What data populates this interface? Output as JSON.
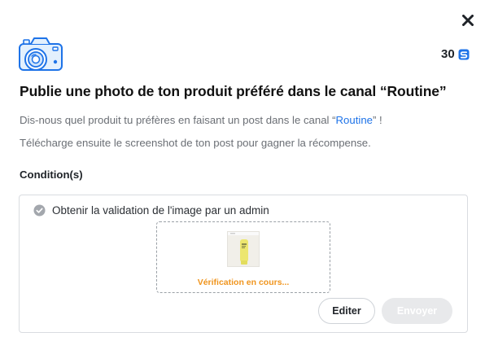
{
  "header": {
    "close_icon": "close-icon",
    "camera_icon": "camera-icon",
    "reward": {
      "value": "30",
      "icon": "coin-icon",
      "color": "#1e73e8"
    }
  },
  "challenge": {
    "title": "Publie une photo de ton produit préféré dans le canal “Routine”",
    "description_1_before": "Dis-nous quel produit tu préfères en faisant un post dans le canal “",
    "description_1_link": "Routine",
    "description_1_after": "” !",
    "description_2": "Télécharge ensuite le screenshot de ton post pour gagner la récompense."
  },
  "conditions": {
    "heading": "Condition(s)",
    "items": [
      {
        "label": "Obtenir la validation de l'image par un admin",
        "icon": "check-circle-icon"
      }
    ]
  },
  "upload": {
    "status": "Vérification en cours...",
    "status_color": "#f0951e"
  },
  "actions": {
    "edit_label": "Editer",
    "send_label": "Envoyer"
  }
}
